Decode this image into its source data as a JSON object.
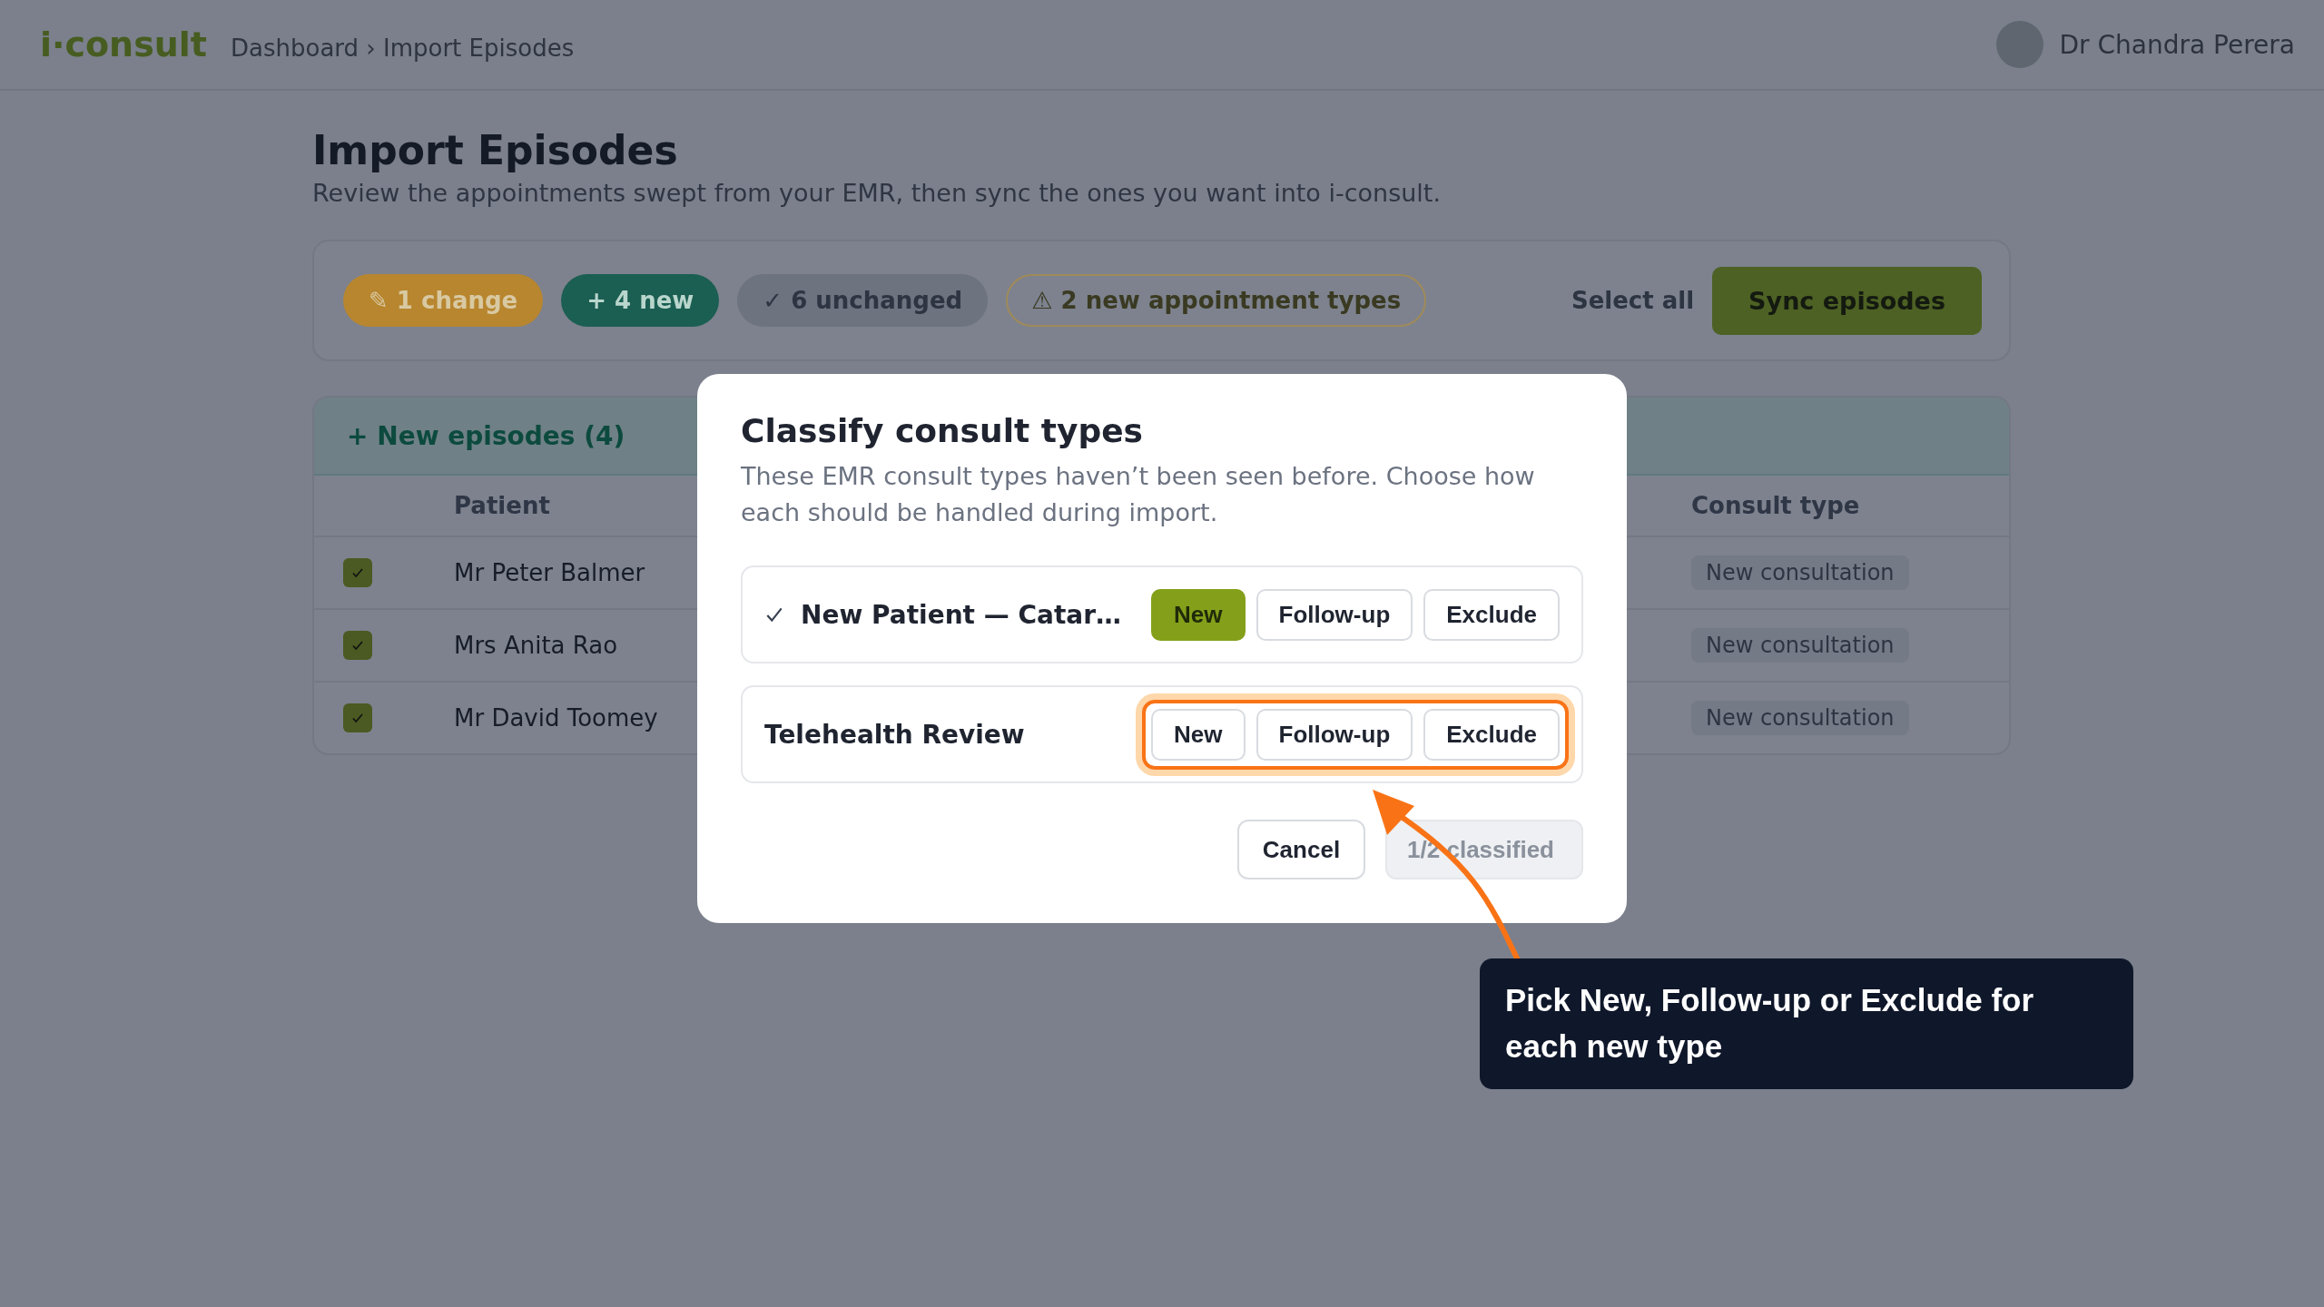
{
  "header": {
    "logo": "i·consult",
    "breadcrumb": "Dashboard › Import Episodes",
    "user": {
      "name": "Dr Chandra Perera"
    }
  },
  "page": {
    "title": "Import Episodes",
    "subtitle": "Review the appointments swept from your EMR, then sync the ones you want into i-consult."
  },
  "summary_chips": [
    {
      "kind": "change",
      "label": "✎ 1 change"
    },
    {
      "kind": "new",
      "label": "+ 4 new"
    },
    {
      "kind": "unchanged",
      "label": "✓ 6 unchanged"
    },
    {
      "kind": "warning",
      "label": "⚠ 2 new appointment types"
    }
  ],
  "toolbar": {
    "select_all": "Select all",
    "sync": "Sync episodes"
  },
  "section": {
    "title": "+ New episodes (4)"
  },
  "table": {
    "columns": [
      "Patient",
      "Consult type"
    ],
    "rows": [
      {
        "checked": true,
        "patient": "Mr Peter Balmer",
        "consult_type": "New consultation"
      },
      {
        "checked": true,
        "patient": "Mrs Anita Rao",
        "consult_type": "New consultation"
      },
      {
        "checked": true,
        "patient": "Mr David Toomey",
        "consult_type": "New consultation"
      }
    ]
  },
  "modal": {
    "title": "Classify consult types",
    "description": "These EMR consult types haven’t been seen before. Choose how each should be handled during import.",
    "items": [
      {
        "name": "New Patient — Catar…",
        "classified": true,
        "highlighted": false,
        "options": [
          {
            "label": "New",
            "selected": true
          },
          {
            "label": "Follow-up",
            "selected": false
          },
          {
            "label": "Exclude",
            "selected": false
          }
        ]
      },
      {
        "name": "Telehealth Review",
        "classified": false,
        "highlighted": true,
        "options": [
          {
            "label": "New",
            "selected": false
          },
          {
            "label": "Follow-up",
            "selected": false
          },
          {
            "label": "Exclude",
            "selected": false
          }
        ]
      }
    ],
    "cancel": "Cancel",
    "confirm": {
      "label": "1/2 classified",
      "disabled": true
    }
  },
  "tooltip": {
    "text": "Pick New, Follow-up or Exclude for each new type"
  }
}
